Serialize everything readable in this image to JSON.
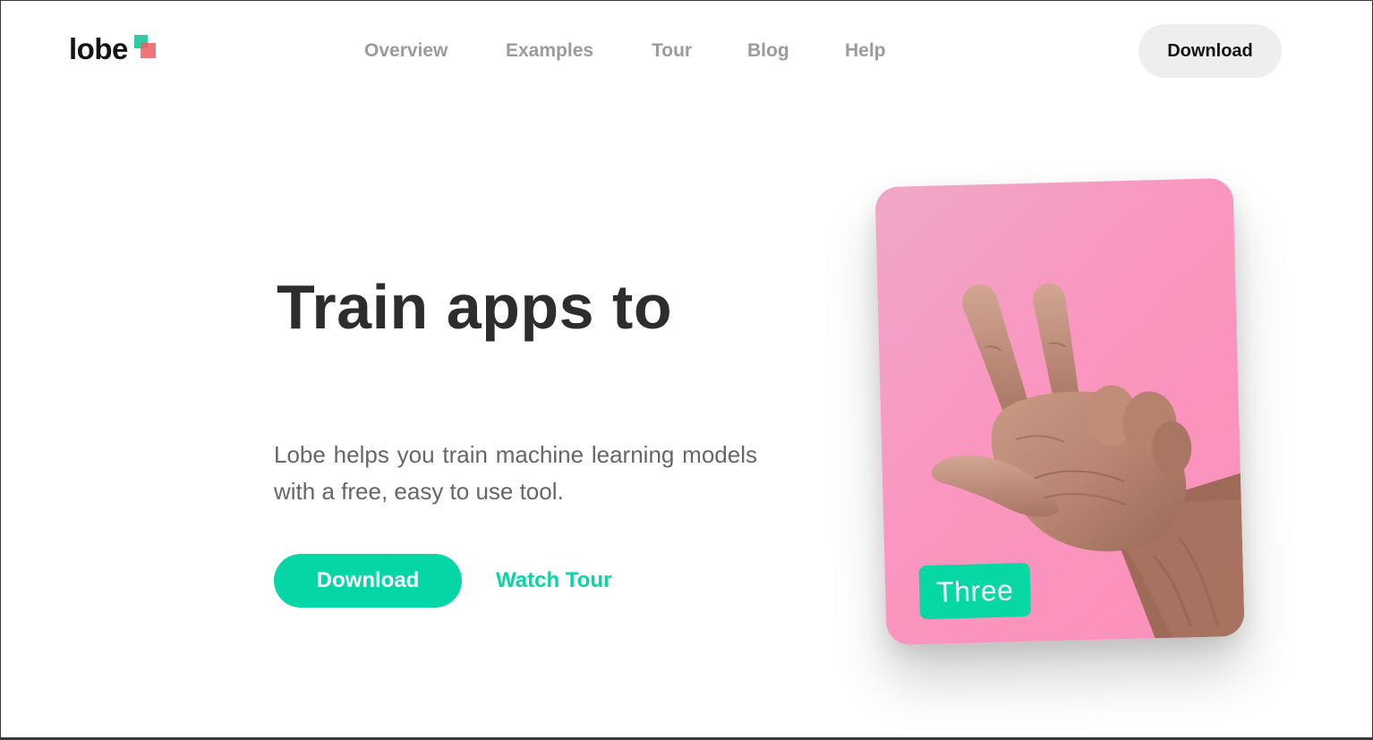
{
  "brand": {
    "name": "lobe",
    "accent": "#06d6a5",
    "mark_colors": [
      "#19c49a",
      "#ee5d5d"
    ]
  },
  "nav": {
    "items": [
      {
        "label": "Overview"
      },
      {
        "label": "Examples"
      },
      {
        "label": "Tour"
      },
      {
        "label": "Blog"
      },
      {
        "label": "Help"
      }
    ],
    "download_label": "Download"
  },
  "hero": {
    "title": "Train apps to",
    "description": "Lobe helps you train machine learning models with a free, easy to use tool.",
    "download_label": "Download",
    "watch_tour_label": "Watch Tour"
  },
  "demo_card": {
    "image": "hand-gesture-three",
    "background": "#fa96bf",
    "label": "Three"
  }
}
